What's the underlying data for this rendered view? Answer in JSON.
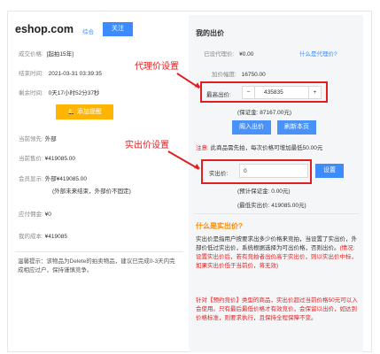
{
  "site": {
    "name": "eshop.com",
    "link": "综合",
    "button": "关注"
  },
  "info": [
    {
      "label": "成交价格:",
      "value": "[起拍15年]"
    },
    {
      "label": "结束时间:",
      "value": "2021-03-31 03:39:35"
    },
    {
      "label": "剩余时间:",
      "value": "0天17小时52分37秒"
    }
  ],
  "remind_button": "添加提醒",
  "details": [
    {
      "label": "当前领先:",
      "value": "外部"
    },
    {
      "label": "当前售价:",
      "value": "¥419085.00"
    },
    {
      "label": "会员显示:",
      "value": "外部¥419085.00"
    },
    {
      "label": "",
      "value": "(外部未来结束，外部价不固定)"
    },
    {
      "label": "应付佣金:",
      "value": "¥0"
    },
    {
      "label": "我的成本:",
      "value": "¥419085"
    }
  ],
  "note_left": "温馨提示：该物品为Delete的拍卖物品，建议已完成0-3天内完成相应过户，保持谨慎竞争。",
  "my_bid": {
    "title": "我的出价",
    "proxy_label": "已设代理价:",
    "proxy_value": "¥0.00",
    "proxy_link": "什么是代理价?",
    "bid_step_label": "加价幅度:",
    "bid_step_value": "16750.00",
    "max_label": "最高出价:",
    "minus": "−",
    "max_value": "435835",
    "plus": "+",
    "deposit_note": "(保证金: 87167.00元)",
    "join_btn": "阁入出价",
    "refresh_btn": "刷新本页",
    "warn_prefix": "注意:",
    "warn_text": "此商品需先拍，每次价格可增加最低50.00元",
    "actual_label": "实出价:",
    "actual_value": "0",
    "set_btn": "设置",
    "actual_deposit": "(预计保证金: 0.00元)",
    "actual_max": "(最低实出价: 419085.00元)"
  },
  "faq": {
    "title": "什么是实出价?",
    "p1_black": "实出价是指用户按要求出多少价格来竞拍，当设置了实出价，外部价低过实出价，系统根据选择为可出价格，否则出价。",
    "p1_red": "(情况: 设置实出价后，若有竞拍者出价高于实出价，则以实出价中标，如果实出价低于当前价，将无效)",
    "p2_red": "针对【预约竞价】类型的商品，实出价超过当前价格50元可以入会使用。只有最后最低价格才有效竞价，会保留以出价，如达到价格标准，则要求执行，且保持全程保障不变。"
  },
  "annotations": {
    "proxy": "代理价设置",
    "actual": "实出价设置"
  },
  "colors": {
    "accent": "#3d8cff",
    "warning": "#ffb400",
    "annotation": "#e02020",
    "faq_title": "#ff8a00"
  }
}
